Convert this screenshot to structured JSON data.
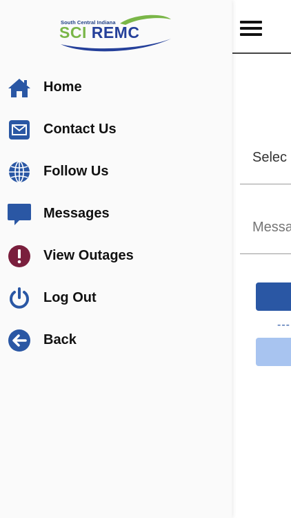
{
  "app": {
    "logo_subtitle": "South Central Indiana",
    "logo_title_part1": "SCI",
    "logo_title_part2": "REMC"
  },
  "colors": {
    "primary_blue": "#2a57a4",
    "logo_green": "#7ab648",
    "outage_red": "#7a1f3d",
    "light_button": "#a8c4f0"
  },
  "menu": {
    "items": [
      {
        "label": "Home",
        "icon": "home-icon"
      },
      {
        "label": "Contact Us",
        "icon": "envelope-icon"
      },
      {
        "label": "Follow Us",
        "icon": "globe-icon"
      },
      {
        "label": "Messages",
        "icon": "chat-bubble-icon"
      },
      {
        "label": "View Outages",
        "icon": "alert-icon"
      },
      {
        "label": "Log Out",
        "icon": "power-icon"
      },
      {
        "label": "Back",
        "icon": "back-arrow-icon"
      }
    ]
  },
  "background_form": {
    "select_label": "Selec",
    "message_placeholder": "Messa",
    "dash_link": "---"
  }
}
